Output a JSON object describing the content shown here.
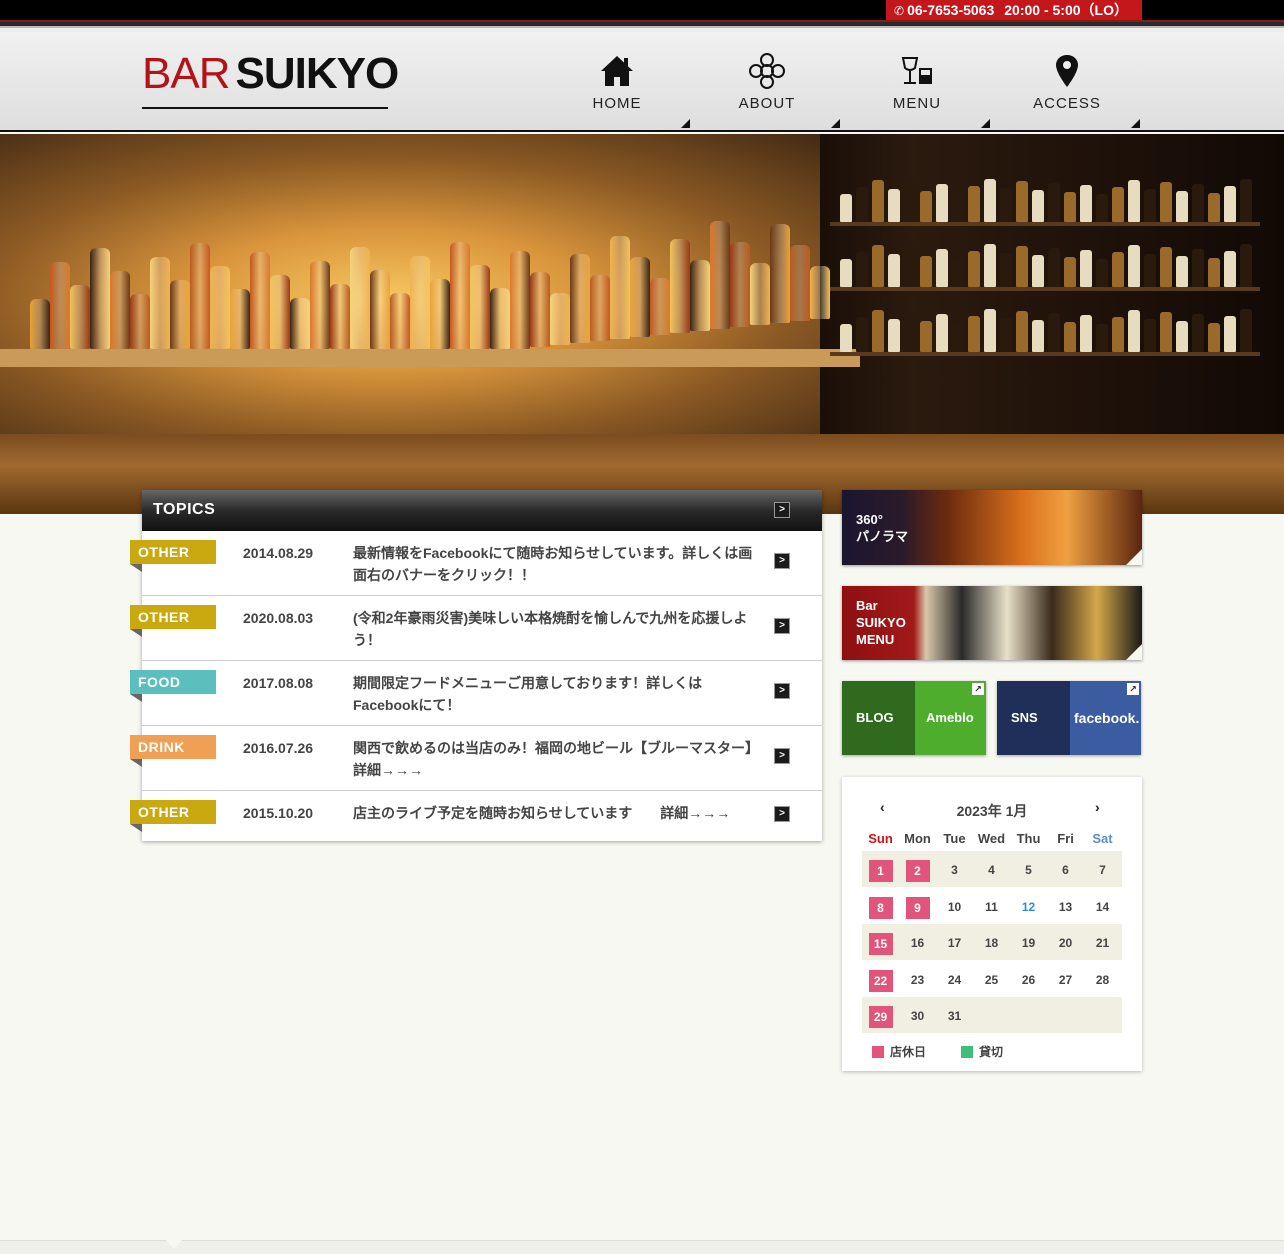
{
  "topbar": {
    "phone": "06-7653-5063",
    "hours": "20:00 - 5:00（LO）",
    "phone_icon": "phone-icon",
    "accent_color": "#c4171c"
  },
  "logo": {
    "part1": "BAR",
    "part2": "SUIKYO"
  },
  "nav": [
    {
      "label": "HOME",
      "icon": "home-icon"
    },
    {
      "label": "ABOUT",
      "icon": "flower-emblem-icon"
    },
    {
      "label": "MENU",
      "icon": "wine-glass-icon"
    },
    {
      "label": "ACCESS",
      "icon": "map-pin-icon"
    }
  ],
  "topics": {
    "title": "TOPICS",
    "items": [
      {
        "tag": "OTHER",
        "date": "2014.08.29",
        "text": "最新情報をFacebookにて随時お知らせしています。詳しくは画面右のバナーをクリック！！"
      },
      {
        "tag": "OTHER",
        "date": "2020.08.03",
        "text": "(令和2年豪雨災害)美味しい本格焼酎を愉しんで九州を応援しよう！"
      },
      {
        "tag": "FOOD",
        "date": "2017.08.08",
        "text": "期間限定フードメニューご用意しております！詳しくはFacebookにて！"
      },
      {
        "tag": "DRINK",
        "date": "2016.07.26",
        "text": "関西で飲めるのは当店のみ！福岡の地ビール【ブルーマスター】　詳細→→→"
      },
      {
        "tag": "OTHER",
        "date": "2015.10.20",
        "text": "店主のライブ予定を随時お知らせしています　　詳細→→→"
      }
    ]
  },
  "banners": {
    "panorama": {
      "line1": "360°",
      "line2": "パノラマ"
    },
    "menu": {
      "line1": "Bar",
      "line2": "SUIKYO",
      "line3": "MENU"
    },
    "blog": {
      "left": "BLOG",
      "right": "Ameblo"
    },
    "sns": {
      "left": "SNS",
      "right": "facebook."
    }
  },
  "calendar": {
    "title": "2023年 1月",
    "prev": "‹",
    "next": "›",
    "dow": [
      "Sun",
      "Mon",
      "Tue",
      "Wed",
      "Thu",
      "Fri",
      "Sat"
    ],
    "weeks": [
      [
        "1",
        "2",
        "3",
        "4",
        "5",
        "6",
        "7"
      ],
      [
        "8",
        "9",
        "10",
        "11",
        "12",
        "13",
        "14"
      ],
      [
        "15",
        "16",
        "17",
        "18",
        "19",
        "20",
        "21"
      ],
      [
        "22",
        "23",
        "24",
        "25",
        "26",
        "27",
        "28"
      ],
      [
        "29",
        "30",
        "31",
        "",
        "",
        "",
        ""
      ]
    ],
    "closed_days": [
      "1",
      "2",
      "8",
      "9",
      "15",
      "22",
      "29"
    ],
    "today": "12",
    "legend": [
      {
        "label": "店休日",
        "color": "#e2557a"
      },
      {
        "label": "貸切",
        "color": "#3bbf7a"
      }
    ]
  }
}
